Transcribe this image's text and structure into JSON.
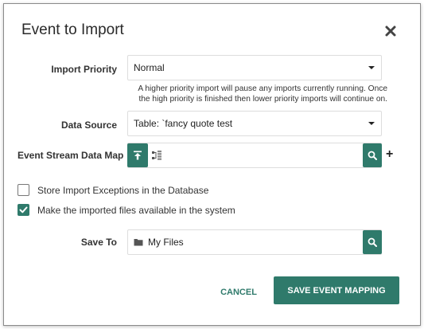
{
  "dialog": {
    "title": "Event to Import",
    "close_icon": "close-icon"
  },
  "import_priority": {
    "label": "Import Priority",
    "value": "Normal",
    "help": "A higher priority import will pause any imports currently running. Once the high priority is finished then lower priority imports will continue on."
  },
  "data_source": {
    "label": "Data Source",
    "value": "Table:  `fancy quote test"
  },
  "event_stream": {
    "label": "Event Stream Data Map",
    "upload_icon": "upload-icon",
    "map_icon": "data-map-icon",
    "value": "",
    "search_icon": "search-icon",
    "add_label": "+"
  },
  "options": {
    "store_exceptions": {
      "label": "Store Import Exceptions in the Database",
      "checked": false
    },
    "make_available": {
      "label": "Make the imported files available in the system",
      "checked": true
    }
  },
  "save_to": {
    "label": "Save To",
    "folder_icon": "folder-icon",
    "value": "My Files",
    "search_icon": "search-icon"
  },
  "footer": {
    "cancel_label": "CANCEL",
    "save_label": "SAVE EVENT MAPPING"
  },
  "colors": {
    "accent": "#2f7a6b"
  }
}
